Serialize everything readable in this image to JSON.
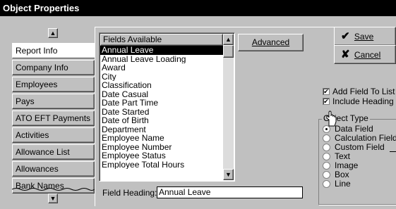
{
  "window": {
    "title": "Object Properties"
  },
  "tabs": [
    {
      "label": "Report Info",
      "active": true
    },
    {
      "label": "Company Info",
      "active": false
    },
    {
      "label": "Employees",
      "active": false
    },
    {
      "label": "Pays",
      "active": false
    },
    {
      "label": "ATO EFT Payments",
      "active": false
    },
    {
      "label": "Activities",
      "active": false
    },
    {
      "label": "Allowance List",
      "active": false
    },
    {
      "label": "Allowances",
      "active": false
    },
    {
      "label": "Bank Names",
      "active": false
    }
  ],
  "fields": {
    "header": "Fields Available",
    "items": [
      "Annual Leave",
      "Annual Leave Loading",
      "Award",
      "City",
      "Classification",
      "Date Casual",
      "Date Part Time",
      "Date Started",
      "Date of Birth",
      "Department",
      "Employee Name",
      "Employee Number",
      "Employee Status",
      "Employee Total Hours"
    ],
    "selected_index": 0
  },
  "advanced_button": {
    "label": "Advanced"
  },
  "save_button": {
    "label": "Save"
  },
  "cancel_button": {
    "label": "Cancel"
  },
  "field_heading": {
    "label": "Field Heading:",
    "value": "Annual Leave"
  },
  "checkboxes": [
    {
      "label": "Add Field To List",
      "checked": true
    },
    {
      "label": "Include Heading",
      "checked": true
    }
  ],
  "object_type": {
    "label": "Object Type",
    "options": [
      "Data Field",
      "Calculation Field",
      "Custom Field",
      "Text",
      "Image",
      "Box",
      "Line"
    ],
    "selected_index": 0
  }
}
